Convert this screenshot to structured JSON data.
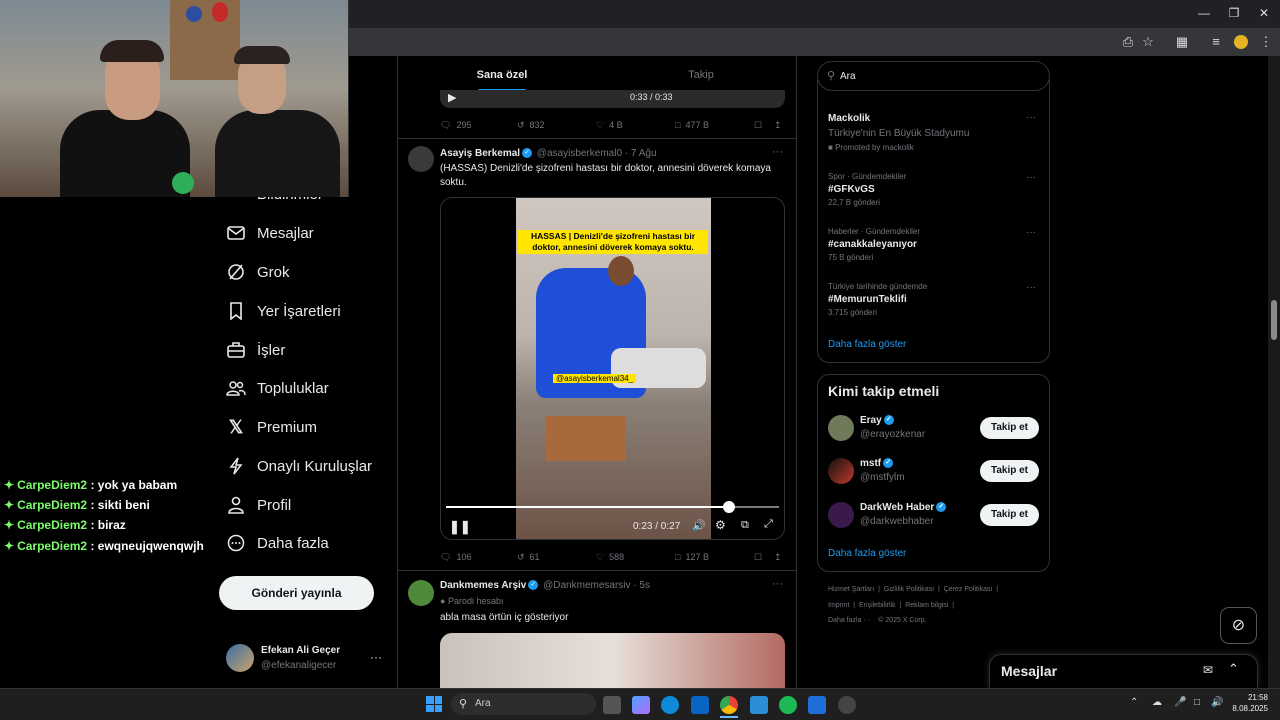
{
  "browser": {
    "toolbar_icons": [
      "cast-icon",
      "star-icon",
      "extensions-icon",
      "reading-list-icon",
      "profile-icon",
      "menu-icon"
    ]
  },
  "chat": [
    {
      "user": "CarpeDiem2",
      "text": ": yok ya babam"
    },
    {
      "user": "CarpeDiem2",
      "text": ": sikti beni"
    },
    {
      "user": "CarpeDiem2",
      "text": ": biraz"
    },
    {
      "user": "CarpeDiem2",
      "text": ": ewqneujqwenqwjh"
    }
  ],
  "nav": {
    "partial_label": "Bildirimler",
    "items": [
      {
        "label": "Mesajlar",
        "icon": "mail-icon"
      },
      {
        "label": "Grok",
        "icon": "grok-icon"
      },
      {
        "label": "Yer İşaretleri",
        "icon": "bookmark-icon"
      },
      {
        "label": "İşler",
        "icon": "briefcase-icon"
      },
      {
        "label": "Topluluklar",
        "icon": "communities-icon"
      },
      {
        "label": "Premium",
        "icon": "x-logo-icon"
      },
      {
        "label": "Onaylı Kuruluşlar",
        "icon": "lightning-icon"
      },
      {
        "label": "Profil",
        "icon": "person-icon"
      },
      {
        "label": "Daha fazla",
        "icon": "more-circle-icon"
      }
    ],
    "post_button": "Gönderi yayınla",
    "account": {
      "name": "Efekan Ali Geçer",
      "handle": "@efekanaligecer"
    }
  },
  "feed": {
    "tabs": [
      "Sana özel",
      "Takip"
    ],
    "top_post": {
      "time": "0:33 / 0:33",
      "replies": "295",
      "reposts": "832",
      "likes": "4 B",
      "views": "477 B"
    },
    "post1": {
      "name": "Asayiş Berkemal",
      "handle": "@asayisberkemal0",
      "date": "· 7 Ağu",
      "text": "(HASSAS) Denizli'de şizofreni hastası bir doktor, annesini döverek komaya soktu.",
      "video_caption": "HASSAS | Denizli'de şizofreni hastası bir doktor, annesini döverek komaya soktu.",
      "watermark": "@asayisberkemal34_",
      "time": "0:23 / 0:27",
      "progress": 0.85,
      "replies": "106",
      "reposts": "61",
      "likes": "588",
      "views": "127 B"
    },
    "post2": {
      "name": "Dankmemes Arşiv",
      "handle": "@Dankmemesarsiv",
      "date": "· 5s",
      "badge": "Parodi hesabı",
      "text": "abla masa örtün iç gösteriyor"
    }
  },
  "right": {
    "search_placeholder": "Ara",
    "promo": {
      "title": "Mackolik",
      "subtitle": "Türkiye'nin En Büyük Stadyumu",
      "promoted": "Promoted by mackolik"
    },
    "trends": [
      {
        "category": "Spor · Gündemdekiler",
        "title": "#GFKvGS",
        "count": "22,7 B gönderi"
      },
      {
        "category": "Haberler · Gündemdekiler",
        "title": "#canakkaleyanıyor",
        "count": "75 B gönderi"
      },
      {
        "category": "Türkiye tarihinde gündemde",
        "title": "#MemurunTeklifi",
        "count": "3.715 gönderi"
      }
    ],
    "show_more": "Daha fazla göster",
    "who_to_follow": {
      "title": "Kimi takip etmeli",
      "users": [
        {
          "name": "Eray",
          "handle": "@erayozkenar",
          "button": "Takip et"
        },
        {
          "name": "mstf",
          "handle": "@mstfylm",
          "button": "Takip et"
        },
        {
          "name": "DarkWeb Haber",
          "handle": "@darkwebhaber",
          "button": "Takip et"
        }
      ],
      "show_more": "Daha fazla göster"
    },
    "footer": [
      "Hizmet Şartları",
      "Gizlilik Politikası",
      "Çerez Politikası",
      "Imprint",
      "Erişilebilirlik",
      "Reklam bilgisi",
      "Daha fazla ···",
      "© 2025 X Corp."
    ],
    "messages_title": "Mesajlar"
  },
  "taskbar": {
    "search": "Ara",
    "time": "21:58",
    "date": "8.08.2025"
  }
}
